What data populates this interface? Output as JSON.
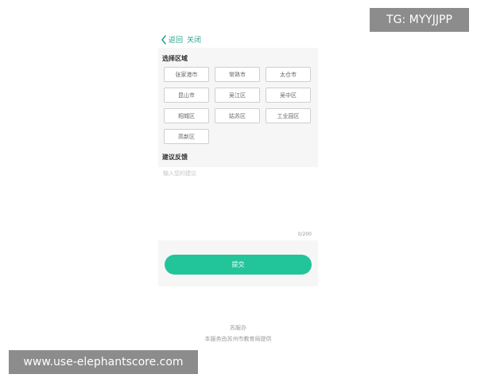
{
  "nav": {
    "back_label": "返回",
    "close_label": "关闭"
  },
  "region": {
    "title": "选择区域",
    "options": [
      "张家港市",
      "常熟市",
      "太仓市",
      "昆山市",
      "吴江区",
      "吴中区",
      "相城区",
      "姑苏区",
      "工业园区",
      "高新区"
    ]
  },
  "feedback": {
    "title": "建议反馈",
    "placeholder": "输入您的建议",
    "value": "",
    "counter": "0/200"
  },
  "submit": {
    "label": "提交"
  },
  "footer": {
    "line1": "苏服办",
    "line2": "本服务由苏州市教育局提供"
  },
  "watermarks": {
    "top_right": "TG: MYYJJPP",
    "bottom_left": "www.use-elephantscore.com"
  },
  "colors": {
    "accent": "#22c59a",
    "link": "#2aa58a"
  }
}
